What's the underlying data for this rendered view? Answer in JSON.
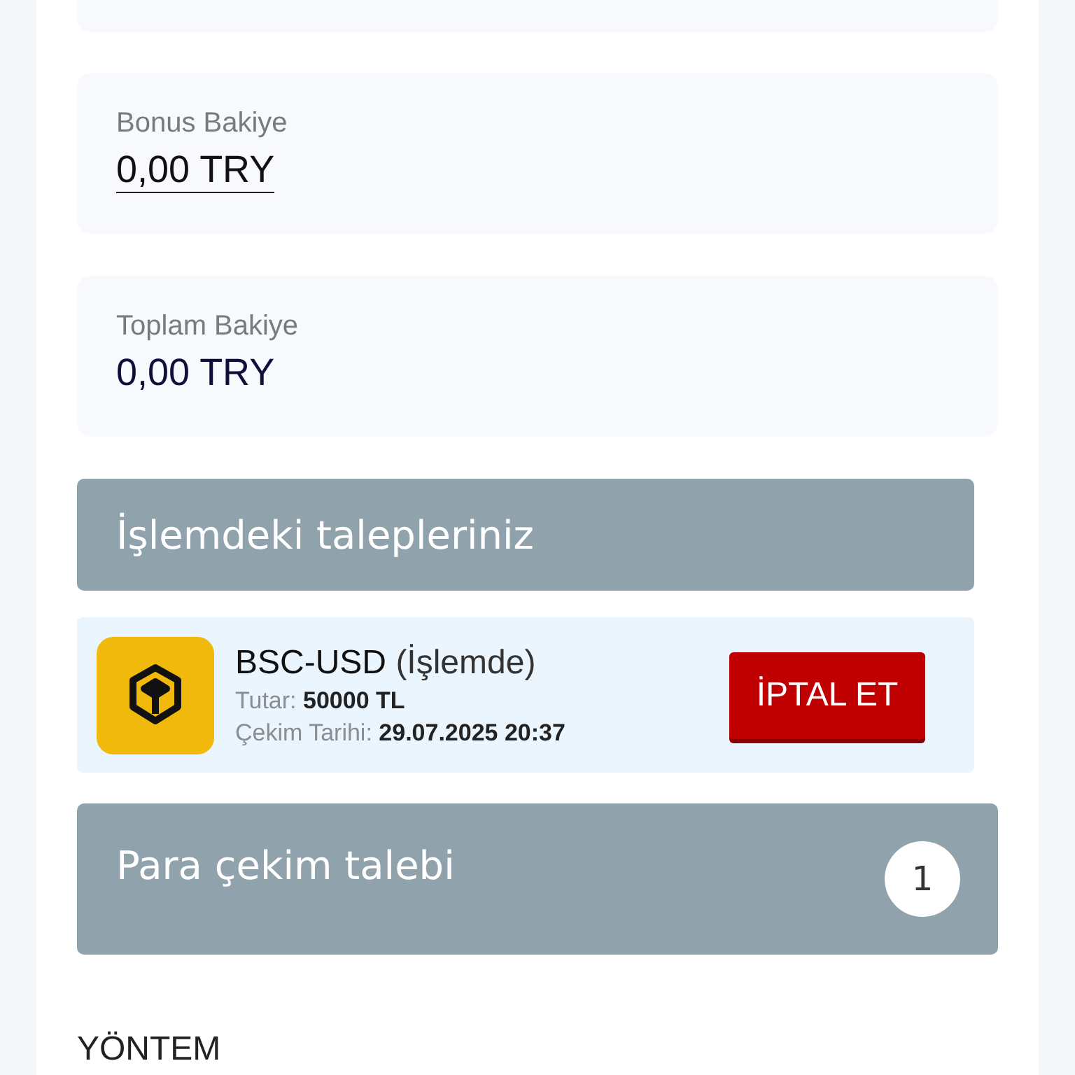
{
  "balances": [
    {
      "label": "Bonus Bakiye",
      "value": "0,00 TRY",
      "underlined": true
    },
    {
      "label": "Toplam Bakiye",
      "value": "0,00 TRY",
      "underlined": false
    }
  ],
  "pending": {
    "title": "İşlemdeki talepleriniz",
    "requests": [
      {
        "name": "BSC-USD",
        "status": "(İşlemde)",
        "amount_label": "Tutar:",
        "amount": "50000 TL",
        "date_label": "Çekim Tarihi:",
        "date": "29.07.2025 20:37",
        "cancel": "İPTAL ET"
      }
    ]
  },
  "withdraw": {
    "title": "Para çekim talebi",
    "step": "1"
  },
  "method_heading": "YÖNTEM"
}
